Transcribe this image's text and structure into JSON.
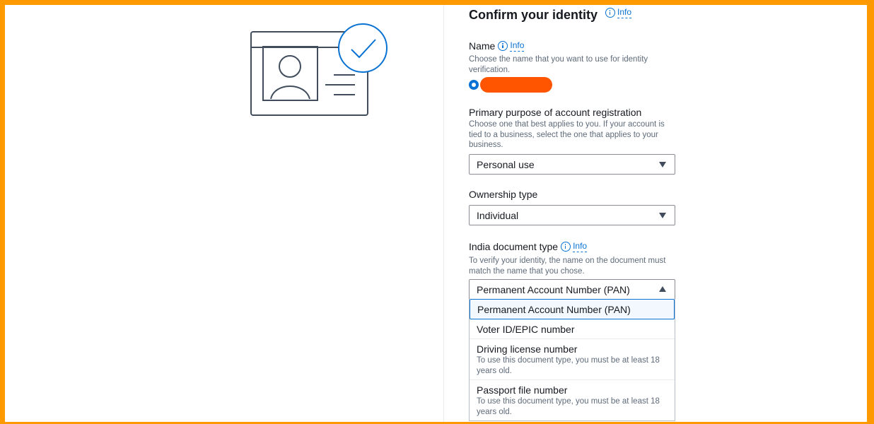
{
  "page": {
    "title": "Confirm your identity",
    "info_link": "Info"
  },
  "name_field": {
    "label": "Name",
    "info_link": "Info",
    "description": "Choose the name that you want to use for identity verification.",
    "redaction_color": "#ff5500"
  },
  "purpose_field": {
    "label": "Primary purpose of account registration",
    "description": "Choose one that best applies to you. If your account is tied to a business, select the one that applies to your business.",
    "selected": "Personal use"
  },
  "ownership_field": {
    "label": "Ownership type",
    "selected": "Individual"
  },
  "document_field": {
    "label": "India document type",
    "info_link": "Info",
    "description": "To verify your identity, the name on the document must match the name that you chose.",
    "selected": "Permanent Account Number (PAN)",
    "options": [
      {
        "label": "Permanent Account Number (PAN)",
        "description": ""
      },
      {
        "label": "Voter ID/EPIC number",
        "description": ""
      },
      {
        "label": "Driving license number",
        "description": "To use this document type, you must be at least 18 years old."
      },
      {
        "label": "Passport file number",
        "description": "To use this document type, you must be at least 18 years old."
      }
    ]
  },
  "colors": {
    "accent": "#ff9900",
    "link": "#0972d3",
    "check_badge": "#0972d3"
  }
}
